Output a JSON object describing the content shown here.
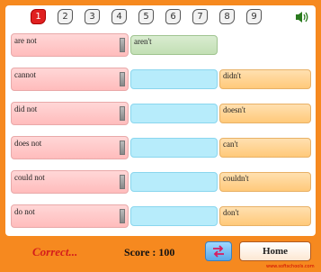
{
  "nav": {
    "numbers": [
      "1",
      "2",
      "3",
      "4",
      "5",
      "6",
      "7",
      "8",
      "9"
    ],
    "active": "1"
  },
  "rows": [
    {
      "word": "are not",
      "answer": "aren't",
      "option": ""
    },
    {
      "word": "cannot",
      "answer": "",
      "option": "didn't"
    },
    {
      "word": "did not",
      "answer": "",
      "option": "doesn't"
    },
    {
      "word": "does not",
      "answer": "",
      "option": "can't"
    },
    {
      "word": "could not",
      "answer": "",
      "option": "couldn't"
    },
    {
      "word": "do not",
      "answer": "",
      "option": "don't"
    }
  ],
  "footer": {
    "status": "Correct...",
    "score_text": "Score : 100",
    "home_label": "Home",
    "credit": "www.softschools.com"
  },
  "icons": {
    "speaker": "speaker-icon",
    "swap": "swap-arrows-icon"
  },
  "colors": {
    "frame": "#f6891f",
    "word_bg": "#ffbcbc",
    "slot_bg": "#b7ecfb",
    "option_bg": "#ffc97a",
    "status": "#d41c1c"
  }
}
